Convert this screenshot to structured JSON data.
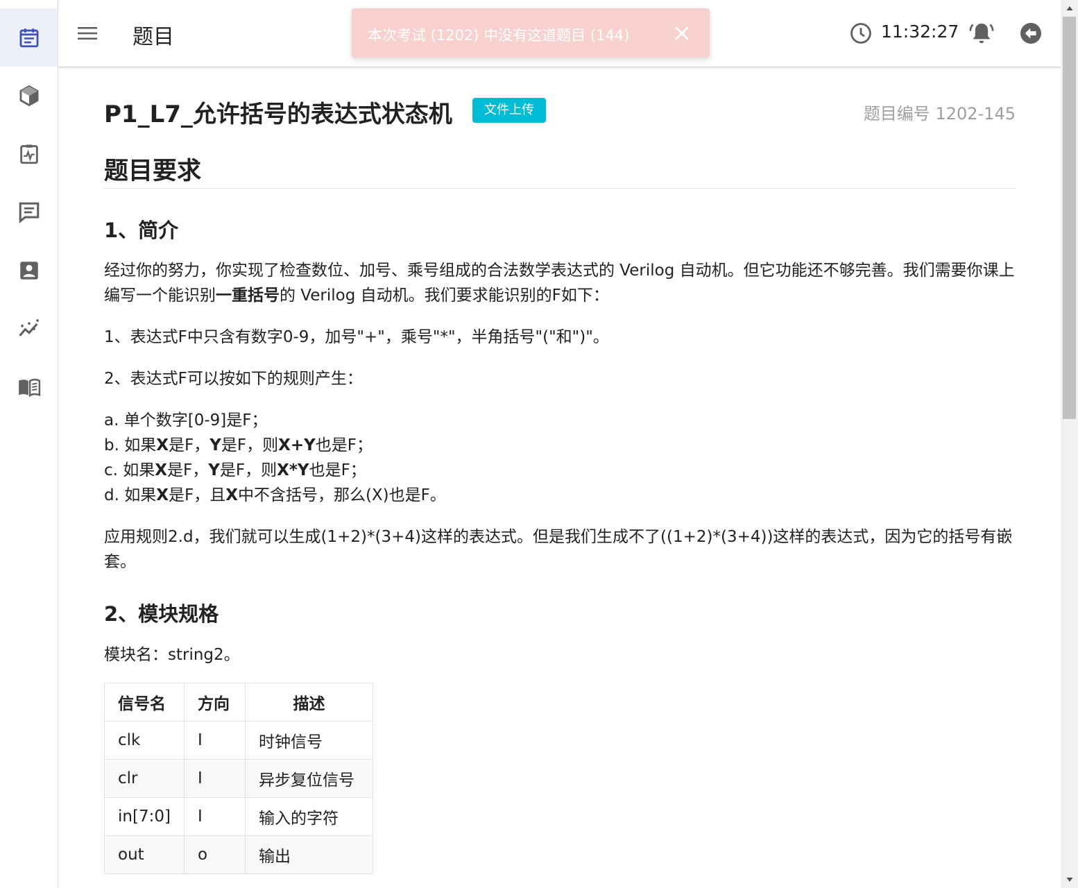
{
  "header": {
    "title": "题目",
    "time": "11:32:27"
  },
  "toast": {
    "message": "本次考试 (1202) 中没有这道题目 (144)"
  },
  "sidebar": {
    "items": [
      {
        "icon": "calendar-list-icon",
        "active": true
      },
      {
        "icon": "cube-icon"
      },
      {
        "icon": "clipboard-pulse-icon"
      },
      {
        "icon": "message-icon"
      },
      {
        "icon": "account-box-icon"
      },
      {
        "icon": "chart-line-icon"
      },
      {
        "icon": "book-open-icon"
      }
    ]
  },
  "problem": {
    "title": "P1_L7_允许括号的表达式状态机",
    "type_chip": "文件上传",
    "id_label": "题目编号 1202-145"
  },
  "content": {
    "requirements_heading": "题目要求",
    "sec1_heading": "1、简介",
    "intro_pre": "经过你的努力，你实现了检查数位、加号、乘号组成的合法数学表达式的 Verilog 自动机。但它功能还不够完善。我们需要你课上编写一个能识别",
    "intro_bold": "一重括号",
    "intro_post": "的 Verilog 自动机。我们要求能识别的F如下：",
    "rule1": "1、表达式F中只含有数字0-9，加号\"+\"，乘号\"*\"，半角括号\"(\"和\")\"。",
    "rule2": "2、表达式F可以按如下的规则产生：",
    "rule_a": "a. 单个数字[0-9]是F；",
    "rule_b_1": "b. 如果",
    "rule_b_x": "X",
    "rule_b_2": "是F，",
    "rule_b_y": "Y",
    "rule_b_3": "是F，则",
    "rule_b_expr": "X+Y",
    "rule_b_4": "也是F；",
    "rule_c_1": "c. 如果",
    "rule_c_x": "X",
    "rule_c_2": "是F，",
    "rule_c_y": "Y",
    "rule_c_3": "是F，则",
    "rule_c_expr": "X*Y",
    "rule_c_4": "也是F；",
    "rule_d_1": "d. 如果",
    "rule_d_x": "X",
    "rule_d_2": "是F，且",
    "rule_d_x2": "X",
    "rule_d_3": "中不含括号，那么(X)也是F。",
    "apply": "应用规则2.d，我们就可以生成(1+2)*(3+4)这样的表达式。但是我们生成不了((1+2)*(3+4))这样的表达式，因为它的括号有嵌套。",
    "sec2_heading": "2、模块规格",
    "module_name": "模块名：string2。"
  },
  "signal_table": {
    "headers": [
      "信号名",
      "方向",
      "描述"
    ],
    "rows": [
      [
        "clk",
        "I",
        "时钟信号"
      ],
      [
        "clr",
        "I",
        "异步复位信号"
      ],
      [
        "in[7:0]",
        "I",
        "输入的字符"
      ],
      [
        "out",
        "o",
        "输出"
      ]
    ]
  },
  "colors": {
    "accent": "#3f51b5",
    "chip": "#00bcd4",
    "toast_bg": "#f8d0ce",
    "icon_grey": "#616161"
  }
}
